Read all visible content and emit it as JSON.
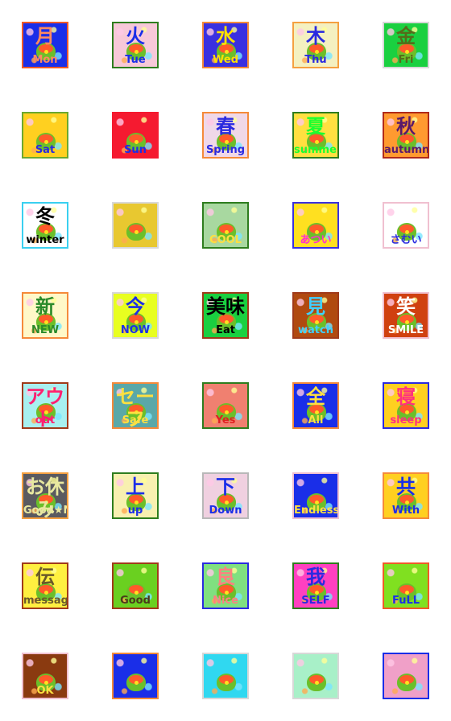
{
  "stickers": [
    {
      "kanji": "月",
      "label": "Mon",
      "bg": "#1a2ee8",
      "border": "#f05a28",
      "color": "#ff8a60"
    },
    {
      "kanji": "火",
      "label": "Tue",
      "bg": "#f7c8d8",
      "border": "#2e7d1e",
      "color": "#1a2ee8"
    },
    {
      "kanji": "水",
      "label": "Wed",
      "bg": "#3a30e0",
      "border": "#f58a3a",
      "color": "#ffe000"
    },
    {
      "kanji": "木",
      "label": "Thu",
      "bg": "#f4f0c0",
      "border": "#f5a040",
      "color": "#2a2ae0"
    },
    {
      "kanji": "金",
      "label": "Fri",
      "bg": "#1ad040",
      "border": "#d8d8d8",
      "color": "#556b1a"
    },
    {
      "kanji": "",
      "label": "Sat",
      "bg": "#ffd020",
      "border": "#6ba830",
      "color": "#2a2ae0"
    },
    {
      "kanji": "",
      "label": "Sun",
      "bg": "#f51a30",
      "border": "#f51a30",
      "color": "#1a2ee8"
    },
    {
      "kanji": "春",
      "label": "Spring",
      "bg": "#f0d8e8",
      "border": "#f58a3a",
      "color": "#2a2ae0"
    },
    {
      "kanji": "夏",
      "label": "summer",
      "bg": "#ffe040",
      "border": "#2e7d1e",
      "color": "#1aff30"
    },
    {
      "kanji": "秋",
      "label": "autumn",
      "bg": "#ff9a30",
      "border": "#b02a1a",
      "color": "#5a1a6a"
    },
    {
      "kanji": "冬",
      "label": "winter",
      "bg": "#ffffff",
      "border": "#3ad0f0",
      "color": "#000000"
    },
    {
      "kanji": "",
      "label": "",
      "bg": "#e8c830",
      "border": "#d8d8d8",
      "color": "#000000"
    },
    {
      "kanji": "",
      "label": "COOL",
      "bg": "#a8d8a0",
      "border": "#2e7d1e",
      "color": "#ffe040"
    },
    {
      "kanji": "",
      "label": "あつい",
      "bg": "#ffe020",
      "border": "#3a30e0",
      "color": "#ff30d0"
    },
    {
      "kanji": "",
      "label": "さむい",
      "bg": "#ffffff",
      "border": "#f0c0d0",
      "color": "#2a2ae0"
    },
    {
      "kanji": "新",
      "label": "NEW",
      "bg": "#fff8c8",
      "border": "#f58a3a",
      "color": "#2a8a2a"
    },
    {
      "kanji": "今",
      "label": "NOW",
      "bg": "#e8ff20",
      "border": "#d8d8d8",
      "color": "#1a2ee8"
    },
    {
      "kanji": "美味",
      "label": "Eat",
      "bg": "#1ad040",
      "border": "#a03a1a",
      "color": "#000000"
    },
    {
      "kanji": "見",
      "label": "watch",
      "bg": "#b04a10",
      "border": "#a03a1a",
      "color": "#40d0ff"
    },
    {
      "kanji": "笑",
      "label": "SMILE",
      "bg": "#d04010",
      "border": "#f0c0d0",
      "color": "#ffffff"
    },
    {
      "kanji": "アウト",
      "label": "out",
      "bg": "#a8f0f0",
      "border": "#a03a1a",
      "color": "#ff2070"
    },
    {
      "kanji": "セーフ",
      "label": "Safe",
      "bg": "#5aa8a8",
      "border": "#f58a3a",
      "color": "#ffe040"
    },
    {
      "kanji": "",
      "label": "Yes",
      "bg": "#f08070",
      "border": "#2e7d1e",
      "color": "#e02020"
    },
    {
      "kanji": "全",
      "label": "All",
      "bg": "#1a2ee8",
      "border": "#f58a3a",
      "color": "#ffe040"
    },
    {
      "kanji": "寝",
      "label": "sleep",
      "bg": "#ffd020",
      "border": "#2a2ae0",
      "color": "#ff3080"
    },
    {
      "kanji": "お休み",
      "label": "Good★Night",
      "bg": "#5a5a60",
      "border": "#f5a040",
      "color": "#e8e8a0"
    },
    {
      "kanji": "上",
      "label": "up",
      "bg": "#f8f0b0",
      "border": "#2e7d1e",
      "color": "#1a2ee8"
    },
    {
      "kanji": "下",
      "label": "Down",
      "bg": "#f0d0e0",
      "border": "#b8b8b8",
      "color": "#1a2ee8"
    },
    {
      "kanji": "",
      "label": "Endless",
      "bg": "#1a2ee8",
      "border": "#f0c0d0",
      "color": "#ffe040"
    },
    {
      "kanji": "共",
      "label": "With",
      "bg": "#ffd020",
      "border": "#f58a3a",
      "color": "#1a2ee8"
    },
    {
      "kanji": "伝",
      "label": "message",
      "bg": "#fff040",
      "border": "#a03a1a",
      "color": "#6a5a2a"
    },
    {
      "kanji": "",
      "label": "Good",
      "bg": "#6ad020",
      "border": "#a03a1a",
      "color": "#4a3a1a"
    },
    {
      "kanji": "良",
      "label": "Nice",
      "bg": "#80e080",
      "border": "#2a2ae0",
      "color": "#ff8080"
    },
    {
      "kanji": "我",
      "label": "SELF",
      "bg": "#ff40c0",
      "border": "#2e7d1e",
      "color": "#2a2ae0"
    },
    {
      "kanji": "",
      "label": "FuLL",
      "bg": "#80e020",
      "border": "#f05a28",
      "color": "#1a2ee8"
    },
    {
      "kanji": "",
      "label": "OK",
      "bg": "#8a3a10",
      "border": "#f0c0d0",
      "color": "#ffe040"
    },
    {
      "kanji": "",
      "label": "",
      "bg": "#1a2ee8",
      "border": "#f58a3a",
      "color": "#000000"
    },
    {
      "kanji": "",
      "label": "",
      "bg": "#30d8f0",
      "border": "#d8d8d8",
      "color": "#000000"
    },
    {
      "kanji": "",
      "label": "",
      "bg": "#a8f0c8",
      "border": "#d8d8d8",
      "color": "#000000"
    },
    {
      "kanji": "",
      "label": "",
      "bg": "#f0a0c8",
      "border": "#1a2ee8",
      "color": "#000000"
    }
  ]
}
